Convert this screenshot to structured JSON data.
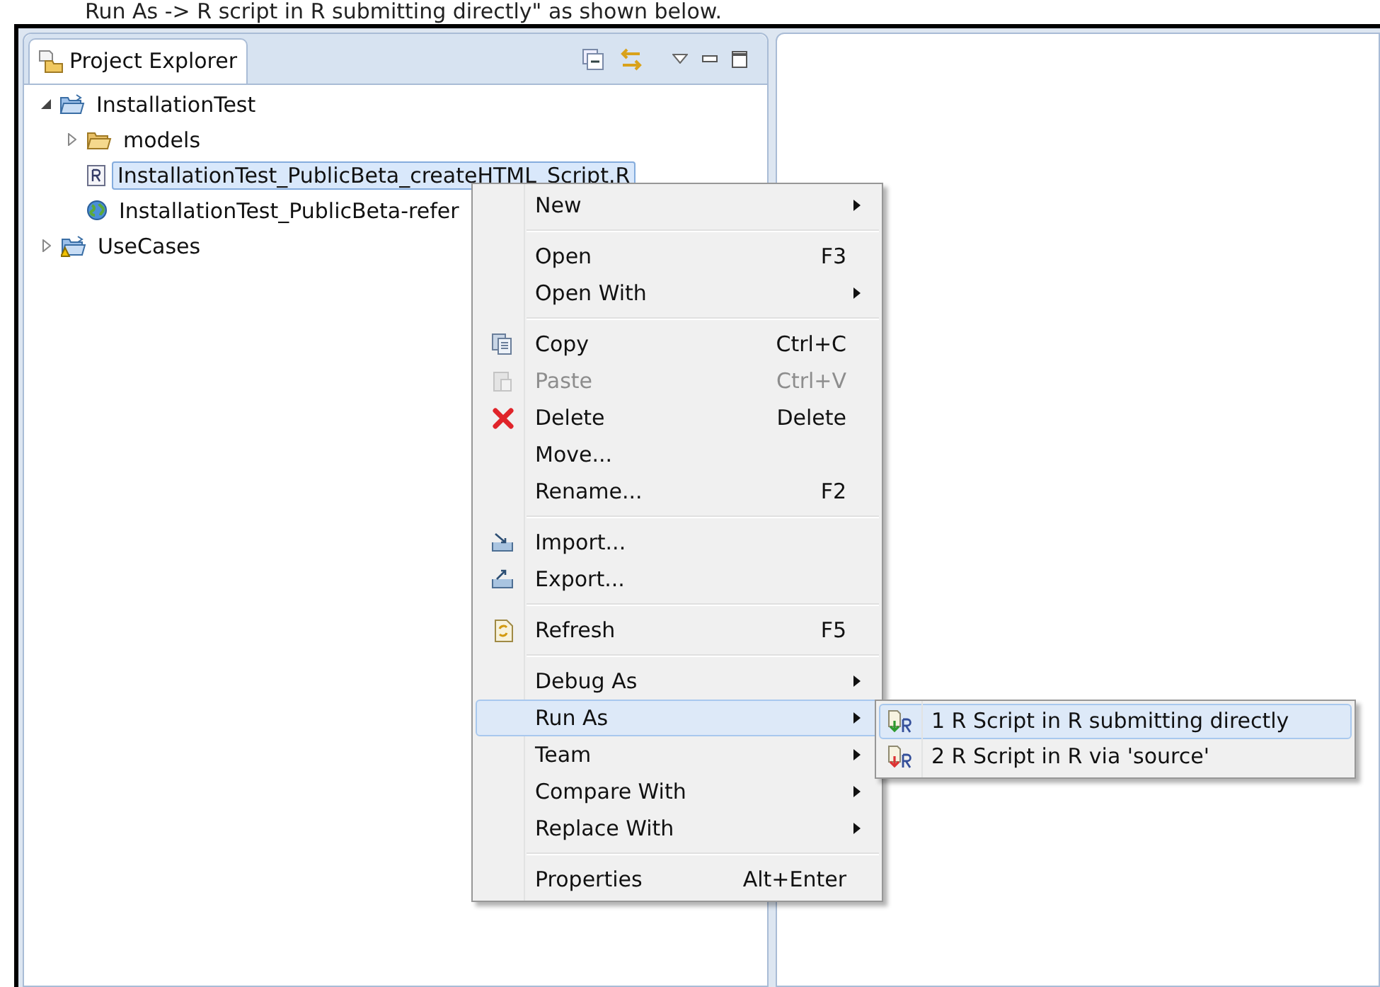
{
  "caption": "Run As -> R script in R submitting directly\" as shown below.",
  "view": {
    "tab_label": "Project Explorer"
  },
  "tree": [
    {
      "label": "InstallationTest",
      "kind": "project",
      "expanded": true,
      "selected": false,
      "children": [
        {
          "label": "models",
          "kind": "folder",
          "expanded": false,
          "selected": false
        },
        {
          "label": "InstallationTest_PublicBeta_createHTML_Script.R",
          "kind": "rfile",
          "selected": true
        },
        {
          "label": "InstallationTest_PublicBeta-refer",
          "kind": "weblink",
          "selected": false
        }
      ]
    },
    {
      "label": "UseCases",
      "kind": "warnproject",
      "expanded": false,
      "selected": false
    }
  ],
  "context_menu": [
    {
      "kind": "plain",
      "label": "New",
      "submenu": true,
      "disabled": false,
      "selected": false
    },
    {
      "kind": "separator"
    },
    {
      "kind": "plain",
      "label": "Open",
      "shortcut": "F3",
      "submenu": false,
      "disabled": false,
      "selected": false
    },
    {
      "kind": "plain",
      "label": "Open With",
      "submenu": true,
      "disabled": false,
      "selected": false
    },
    {
      "kind": "separator"
    },
    {
      "kind": "copy",
      "label": "Copy",
      "shortcut": "Ctrl+C",
      "submenu": false,
      "disabled": false,
      "selected": false
    },
    {
      "kind": "paste",
      "label": "Paste",
      "shortcut": "Ctrl+V",
      "submenu": false,
      "disabled": true,
      "selected": false
    },
    {
      "kind": "delete",
      "label": "Delete",
      "shortcut": "Delete",
      "submenu": false,
      "disabled": false,
      "selected": false
    },
    {
      "kind": "plain",
      "label": "Move...",
      "submenu": false,
      "disabled": false,
      "selected": false
    },
    {
      "kind": "plain",
      "label": "Rename...",
      "shortcut": "F2",
      "submenu": false,
      "disabled": false,
      "selected": false
    },
    {
      "kind": "separator"
    },
    {
      "kind": "import",
      "label": "Import...",
      "submenu": false,
      "disabled": false,
      "selected": false
    },
    {
      "kind": "export",
      "label": "Export...",
      "submenu": false,
      "disabled": false,
      "selected": false
    },
    {
      "kind": "separator"
    },
    {
      "kind": "refresh",
      "label": "Refresh",
      "shortcut": "F5",
      "submenu": false,
      "disabled": false,
      "selected": false
    },
    {
      "kind": "separator"
    },
    {
      "kind": "plain",
      "label": "Debug As",
      "submenu": true,
      "disabled": false,
      "selected": false
    },
    {
      "kind": "plain",
      "label": "Run As",
      "submenu": true,
      "disabled": false,
      "selected": true
    },
    {
      "kind": "plain",
      "label": "Team",
      "submenu": true,
      "disabled": false,
      "selected": false
    },
    {
      "kind": "plain",
      "label": "Compare With",
      "submenu": true,
      "disabled": false,
      "selected": false
    },
    {
      "kind": "plain",
      "label": "Replace With",
      "submenu": true,
      "disabled": false,
      "selected": false
    },
    {
      "kind": "separator"
    },
    {
      "kind": "plain",
      "label": "Properties",
      "shortcut": "Alt+Enter",
      "submenu": false,
      "disabled": false,
      "selected": false
    }
  ],
  "submenu": [
    {
      "label": "1 R Script in R submitting directly",
      "selected": true
    },
    {
      "label": "2 R Script in R via 'source'",
      "selected": false
    }
  ]
}
